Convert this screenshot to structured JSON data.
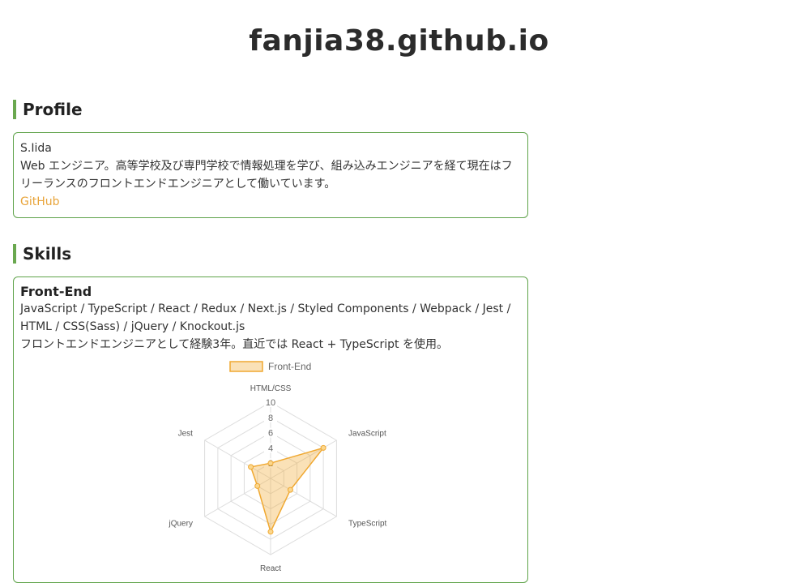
{
  "site": {
    "title": "fanjia38.github.io"
  },
  "profile": {
    "heading": "Profile",
    "name": "S.Iida",
    "bio": "Web エンジニア。高等学校及び専門学校で情報処理を学び、組み込みエンジニアを経て現在はフリーランスのフロントエンドエンジニアとして働いています。",
    "link_label": "GitHub"
  },
  "skills": {
    "heading": "Skills",
    "frontend": {
      "title": "Front-End",
      "tech": "JavaScript / TypeScript / React / Redux / Next.js / Styled Components / Webpack / Jest / HTML / CSS(Sass) / jQuery / Knockout.js",
      "note": "フロントエンドエンジニアとして経験3年。直近では React + TypeScript を使用。"
    }
  },
  "chart_data": {
    "type": "radar",
    "categories": [
      "HTML/CSS",
      "JavaScript",
      "TypeScript",
      "React",
      "jQuery",
      "Jest"
    ],
    "series": [
      {
        "name": "Front-End",
        "values": [
          2,
          8,
          3,
          7,
          2,
          3
        ],
        "color": "#f0a830",
        "fill": "rgba(240,168,48,0.35)"
      }
    ],
    "rlim": [
      0,
      10
    ],
    "ticks": [
      "2",
      "4",
      "6",
      "8",
      "10"
    ],
    "legend": "top"
  }
}
